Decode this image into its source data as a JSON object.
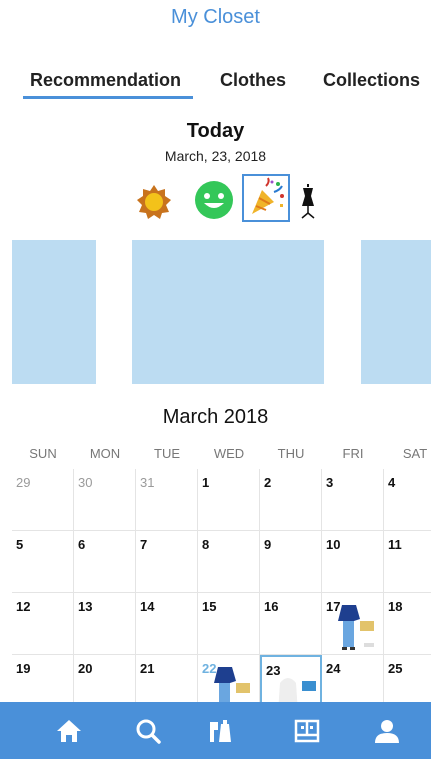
{
  "header": {
    "title": "My Closet"
  },
  "tabs": [
    {
      "label": "Recommendation",
      "active": true
    },
    {
      "label": "Clothes",
      "active": false
    },
    {
      "label": "Collections",
      "active": false
    }
  ],
  "today": {
    "heading": "Today",
    "date": "March, 23,  2018"
  },
  "occasion_icons": [
    {
      "icon": "sun-icon"
    },
    {
      "icon": "smiley-icon"
    },
    {
      "icon": "party-popper-icon",
      "selected": true
    },
    {
      "icon": "dress-form-icon"
    }
  ],
  "calendar": {
    "month_label": "March 2018",
    "weekdays": [
      "SUN",
      "MON",
      "TUE",
      "WED",
      "THU",
      "FRI",
      "SAT"
    ],
    "weeks": [
      [
        "29",
        "30",
        "31",
        "1",
        "2",
        "3",
        "4"
      ],
      [
        "5",
        "6",
        "7",
        "8",
        "9",
        "10",
        "11"
      ],
      [
        "12",
        "13",
        "14",
        "15",
        "16",
        "17",
        "18"
      ],
      [
        "19",
        "20",
        "21",
        "22",
        "23",
        "24",
        "25"
      ]
    ],
    "selected_day": "23"
  },
  "nav": [
    {
      "icon": "home-icon"
    },
    {
      "icon": "search-icon"
    },
    {
      "icon": "wardrobe-icon"
    },
    {
      "icon": "photo-board-icon"
    },
    {
      "icon": "profile-icon"
    }
  ],
  "colors": {
    "accent": "#4a90d9",
    "card": "#bcdcf2"
  }
}
